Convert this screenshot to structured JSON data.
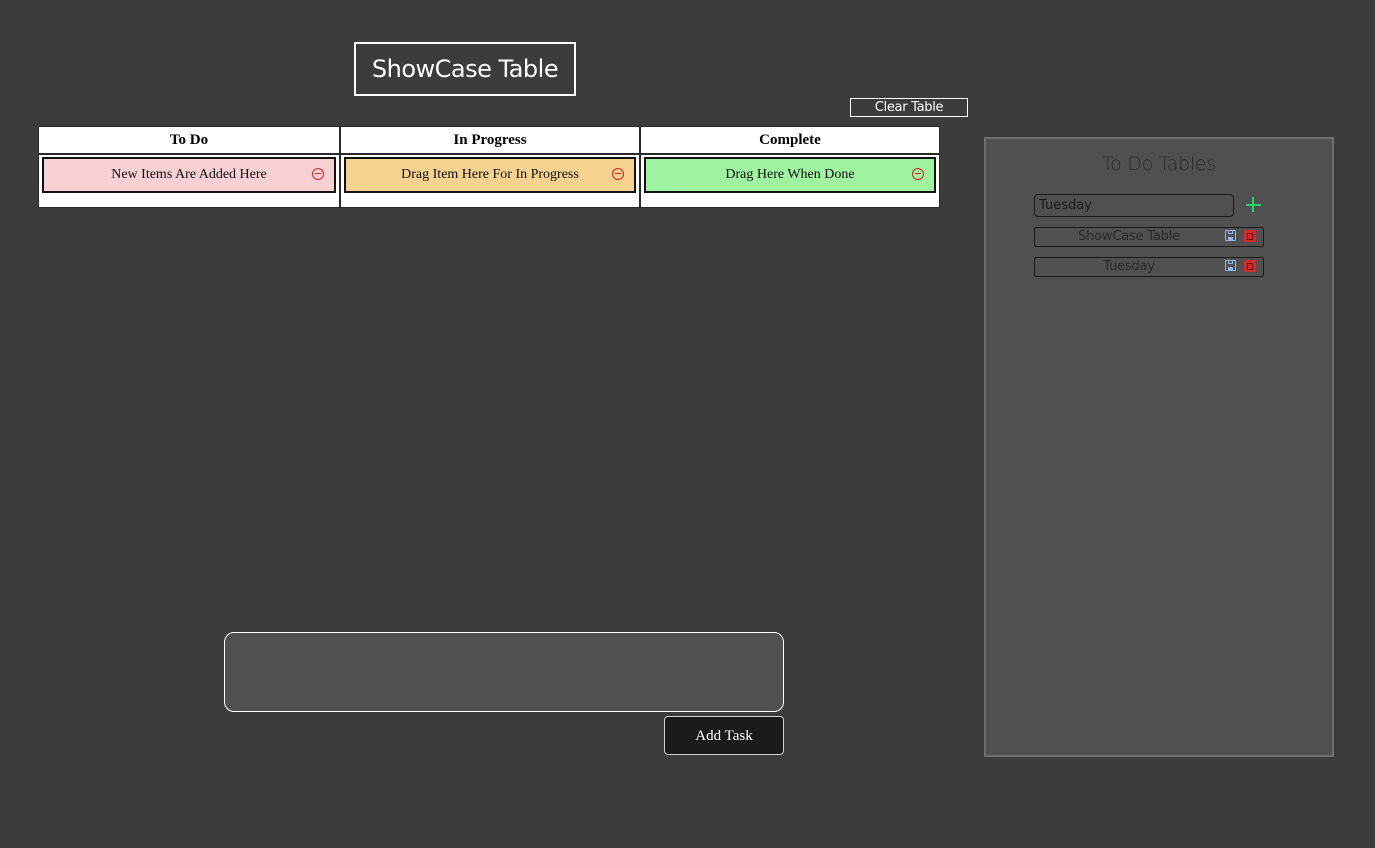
{
  "header": {
    "table_title": "ShowCase Table",
    "clear_button_label": "Clear Table"
  },
  "board": {
    "columns": [
      {
        "title": "To Do",
        "card": "New Items Are Added Here",
        "card_color": "#f6d0d3"
      },
      {
        "title": "In Progress",
        "card": "Drag Item Here For In Progress",
        "card_color": "#f5d290"
      },
      {
        "title": "Complete",
        "card": "Drag Here When Done",
        "card_color": "#9ff29f"
      }
    ],
    "remove_icon": "minus-circle-icon"
  },
  "composer": {
    "task_input_value": "",
    "add_task_label": "Add Task"
  },
  "sidebar": {
    "title": "To Do Tables",
    "new_table_input_value": "Tuesday",
    "add_icon": "plus-icon",
    "tables": [
      {
        "name": "ShowCase Table"
      },
      {
        "name": "Tuesday"
      }
    ]
  },
  "colors": {
    "background": "#3c3c3c",
    "panel": "#505050",
    "add_accent": "#23d66a",
    "delete_accent": "#d42a2a",
    "save_accent": "#8fb8e8"
  }
}
